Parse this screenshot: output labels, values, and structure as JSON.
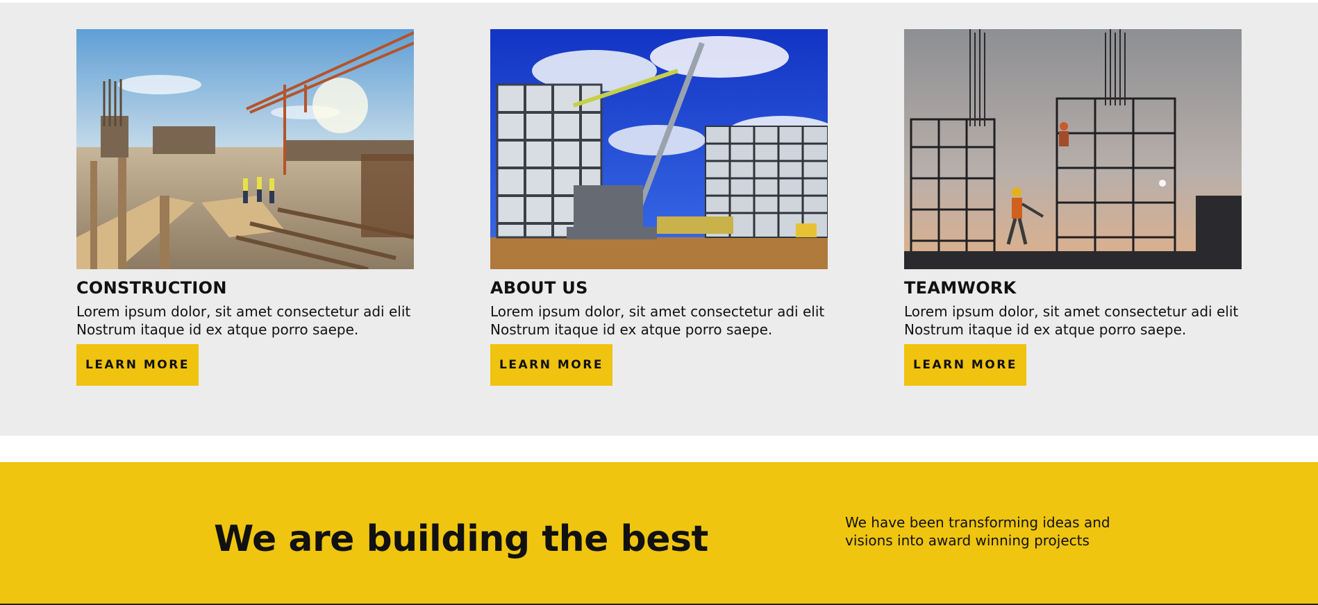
{
  "cards": [
    {
      "title": "CONSTRUCTION",
      "text": "Lorem ipsum dolor, sit amet consectetur adi elit Nostrum itaque id ex atque porro saepe.",
      "button_label": "LEARN MORE",
      "image_alt": "construction site with crane and workers"
    },
    {
      "title": "ABOUT US",
      "text": "Lorem ipsum dolor, sit amet consectetur adi elit Nostrum itaque id ex atque porro saepe.",
      "button_label": "LEARN MORE",
      "image_alt": "building frame with crawler crane under blue sky"
    },
    {
      "title": "TEAMWORK",
      "text": "Lorem ipsum dolor, sit amet consectetur adi elit Nostrum itaque id ex atque porro saepe.",
      "button_label": "LEARN MORE",
      "image_alt": "workers on steel scaffolding at dusk"
    }
  ],
  "banner": {
    "heading": "We are building the best",
    "text": "We have been transforming ideas and visions into award winning projects"
  },
  "colors": {
    "accent": "#efc30f",
    "section_bg": "#ececec",
    "text": "#111111"
  }
}
